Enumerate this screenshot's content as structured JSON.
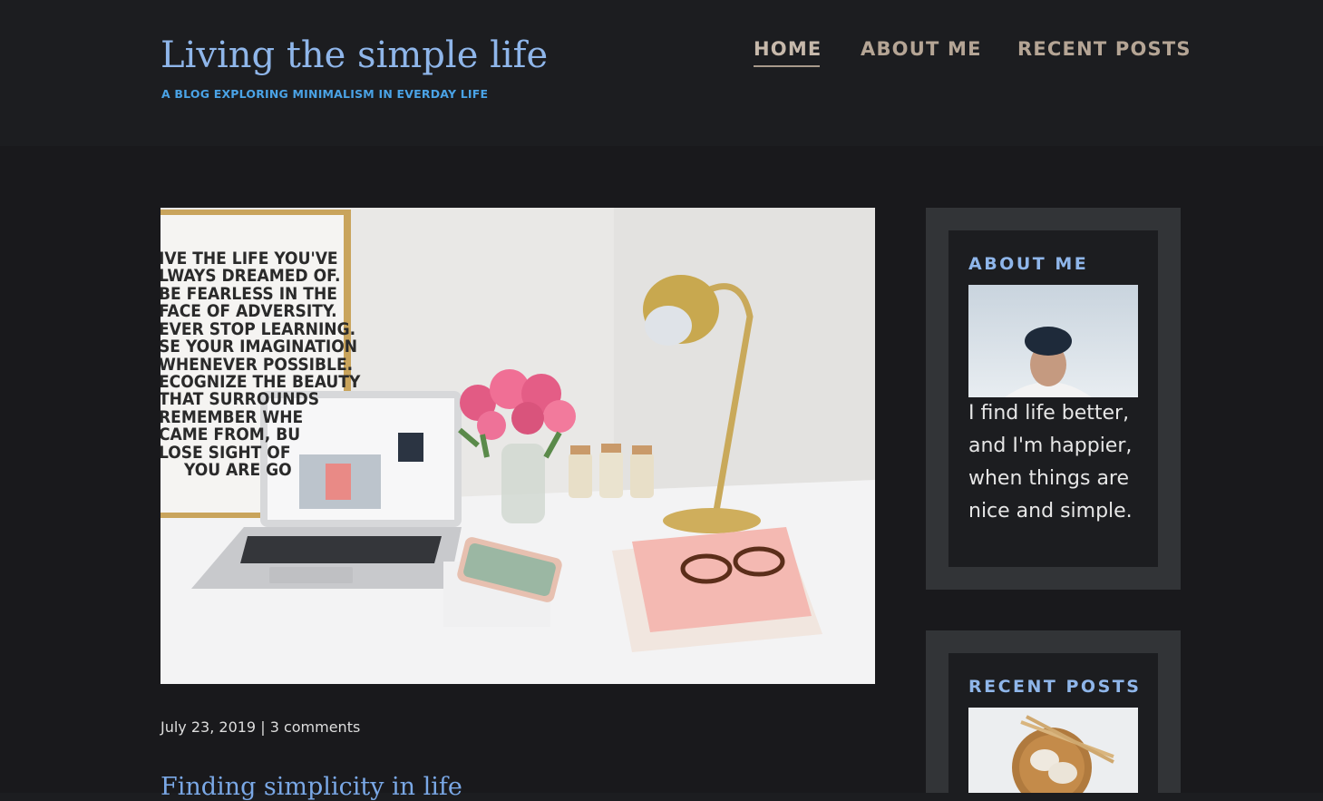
{
  "header": {
    "title": "Living the simple life",
    "subtitle": "A BLOG EXPLORING MINIMALISM IN EVERDAY LIFE"
  },
  "nav": {
    "items": [
      {
        "label": "HOME",
        "active": true
      },
      {
        "label": "ABOUT ME",
        "active": false
      },
      {
        "label": "RECENT POSTS",
        "active": false
      }
    ]
  },
  "post": {
    "image_alt": "Desk with laptop, pink roses, brass lamp, notebooks and glasses",
    "poster_lines": [
      "IVE THE LIFE YOU'VE",
      "LWAYS DREAMED OF.",
      "BE FEARLESS IN THE",
      "FACE OF ADVERSITY.",
      "EVER STOP LEARNING.",
      "SE YOUR IMAGINATION",
      "WHENEVER POSSIBLE.",
      "ECOGNIZE THE BEAUTY",
      "THAT SURROUNDS",
      "REMEMBER WHE",
      "CAME FROM, BU",
      "LOSE SIGHT OF",
      "YOU ARE GO"
    ],
    "date": "July 23, 2019",
    "comments": "3 comments",
    "title": "Finding simplicity in life"
  },
  "sidebar": {
    "about": {
      "title": "ABOUT ME",
      "text": "I find life better, and I'm happier, when things are nice and simple."
    },
    "recent": {
      "title": "RECENT POSTS"
    }
  },
  "colors": {
    "background": "#1c1d20",
    "accent_blue": "#8fb6ea",
    "subtitle_blue": "#4aa3e6",
    "nav_tan": "#b5a595",
    "widget_frame": "#323437"
  }
}
